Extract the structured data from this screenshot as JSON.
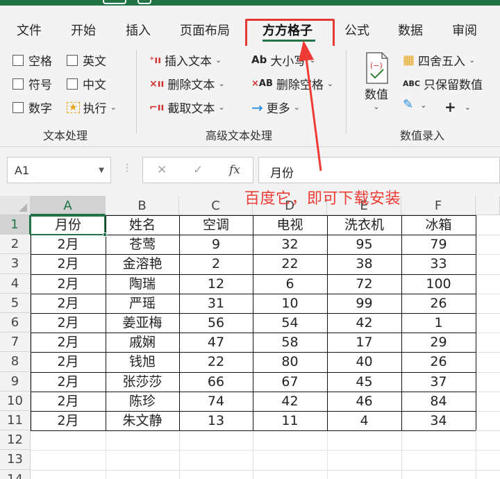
{
  "menu": {
    "tabs": [
      {
        "label": "文件"
      },
      {
        "label": "开始"
      },
      {
        "label": "插入"
      },
      {
        "label": "页面布局"
      },
      {
        "label": "方方格子",
        "active": true
      },
      {
        "label": "公式"
      },
      {
        "label": "数据"
      },
      {
        "label": "审阅"
      }
    ]
  },
  "ribbon": {
    "text_group": {
      "label": "文本处理",
      "checkboxes": [
        "空格",
        "英文",
        "符号",
        "中文",
        "数字"
      ],
      "execute": "执行"
    },
    "advanced_group": {
      "label": "高级文本处理",
      "insert_text": "插入文本",
      "delete_text": "删除文本",
      "extract_text": "截取文本",
      "case_prefix": "Ab",
      "case": "大小写",
      "delete_space_prefix": "AB",
      "delete_space": "删除空格",
      "more": "更多"
    },
    "number_group": {
      "label": "数值录入",
      "number_button": "数值",
      "round": "四舍五入",
      "keep_prefix": "ABC",
      "keep_numbers": "只保留数值"
    }
  },
  "formula_bar": {
    "name_box": "A1",
    "fx_label": "fx",
    "value": "月份"
  },
  "annotation": {
    "text": "百度它，即可下载安装",
    "color": "#ef3b33"
  },
  "sheet": {
    "columns": [
      "A",
      "B",
      "C",
      "D",
      "E",
      "F"
    ],
    "row_numbers": [
      "1",
      "2",
      "3",
      "4",
      "5",
      "6",
      "7",
      "8",
      "9",
      "10",
      "11",
      "12",
      "13",
      "14"
    ],
    "header": [
      "月份",
      "姓名",
      "空调",
      "电视",
      "洗衣机",
      "冰箱"
    ],
    "rows": [
      [
        "2月",
        "苍莺",
        "9",
        "32",
        "95",
        "79"
      ],
      [
        "2月",
        "金溶艳",
        "2",
        "22",
        "38",
        "33"
      ],
      [
        "2月",
        "陶瑞",
        "12",
        "6",
        "72",
        "100"
      ],
      [
        "2月",
        "严瑶",
        "31",
        "10",
        "99",
        "26"
      ],
      [
        "2月",
        "姜亚梅",
        "56",
        "54",
        "42",
        "1"
      ],
      [
        "2月",
        "戚娴",
        "47",
        "58",
        "17",
        "29"
      ],
      [
        "2月",
        "钱旭",
        "22",
        "80",
        "40",
        "26"
      ],
      [
        "2月",
        "张莎莎",
        "66",
        "67",
        "45",
        "37"
      ],
      [
        "2月",
        "陈珍",
        "74",
        "42",
        "46",
        "84"
      ],
      [
        "2月",
        "朱文静",
        "13",
        "11",
        "4",
        "34"
      ]
    ],
    "selected_cell": "A1"
  },
  "colors": {
    "accent": "#217346",
    "highlight": "#e53935",
    "ribbon_bg": "#f3f3f3"
  }
}
